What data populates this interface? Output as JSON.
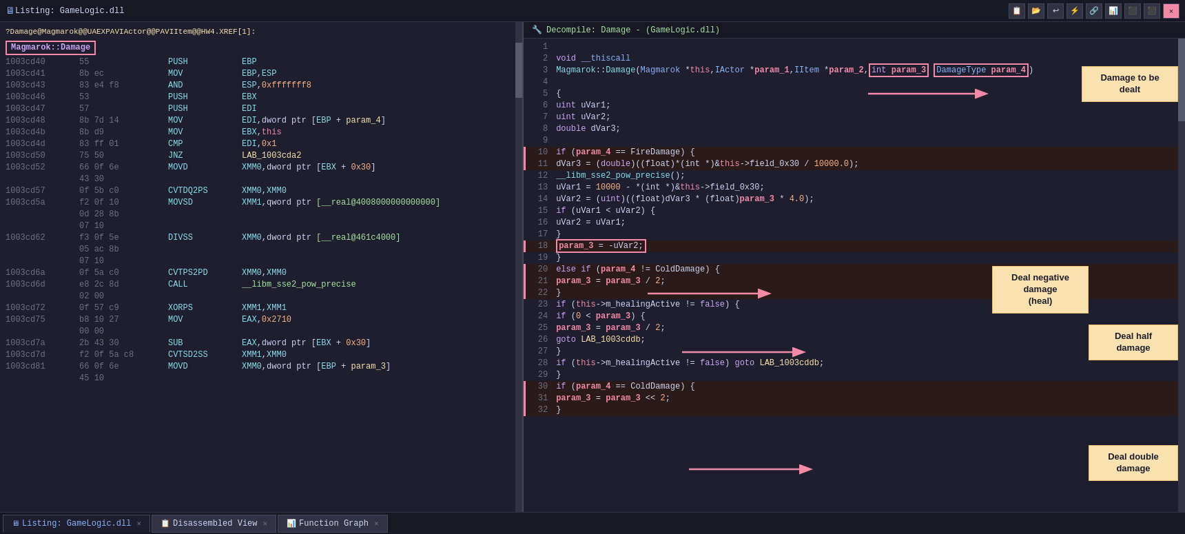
{
  "toolbar": {
    "title": "Listing:  GameLogic.dll",
    "close_label": "×",
    "icons": [
      "📋",
      "📂",
      "↩",
      "⚡",
      "🔗",
      "📊",
      "⬛"
    ]
  },
  "decompile_header": {
    "title": "Decompile: Damage -  (GameLogic.dll)"
  },
  "listing": {
    "xref_line": "?Damage@Magmarok@@UAEXPAVIActor@@PAVIItem@@HW4.XREF[1]:",
    "damage_label": "Magmarok::Damage",
    "rows": [
      {
        "addr": "1003cd40",
        "bytes": "55",
        "mnem": "PUSH",
        "op": "EBP"
      },
      {
        "addr": "1003cd41",
        "bytes": "8b ec",
        "mnem": "MOV",
        "op": "EBP,ESP"
      },
      {
        "addr": "1003cd43",
        "bytes": "83 e4 f8",
        "mnem": "AND",
        "op": "ESP,0xfffffff8"
      },
      {
        "addr": "1003cd46",
        "bytes": "53",
        "mnem": "PUSH",
        "op": "EBX"
      },
      {
        "addr": "1003cd47",
        "bytes": "57",
        "mnem": "PUSH",
        "op": "EDI"
      },
      {
        "addr": "1003cd48",
        "bytes": "8b 7d 14",
        "mnem": "MOV",
        "op": "EDI,dword ptr [EBP + param_4]"
      },
      {
        "addr": "1003cd4b",
        "bytes": "8b d9",
        "mnem": "MOV",
        "op": "EBX,this"
      },
      {
        "addr": "1003cd4d",
        "bytes": "83 ff 01",
        "mnem": "CMP",
        "op": "EDI,0x1"
      },
      {
        "addr": "1003cd50",
        "bytes": "75 50",
        "mnem": "JNZ",
        "op": "LAB_1003cda2"
      },
      {
        "addr": "1003cd52",
        "bytes": "66 0f 6e",
        "mnem": "MOVD",
        "op": "XMM0,dword ptr [EBX + 0x30]"
      },
      {
        "addr": "",
        "bytes": "43 30",
        "mnem": "",
        "op": ""
      },
      {
        "addr": "1003cd57",
        "bytes": "0f 5b c0",
        "mnem": "CVTDQ2PS",
        "op": "XMM0,XMM0"
      },
      {
        "addr": "1003cd5a",
        "bytes": "f2 0f 10",
        "mnem": "MOVSD",
        "op": "XMM1,qword ptr [__real@4008000000000000]"
      },
      {
        "addr": "",
        "bytes": "0d 28 8b",
        "mnem": "",
        "op": ""
      },
      {
        "addr": "",
        "bytes": "07 10",
        "mnem": "",
        "op": ""
      },
      {
        "addr": "1003cd62",
        "bytes": "f3 0f 5e",
        "mnem": "DIVSS",
        "op": "XMM0,dword ptr [__real@461c4000]"
      },
      {
        "addr": "",
        "bytes": "05 ac 8b",
        "mnem": "",
        "op": ""
      },
      {
        "addr": "",
        "bytes": "07 10",
        "mnem": "",
        "op": ""
      },
      {
        "addr": "1003cd6a",
        "bytes": "0f 5a c0",
        "mnem": "CVTPS2PD",
        "op": "XMM0,XMM0"
      },
      {
        "addr": "1003cd6d",
        "bytes": "e8 2c 8d",
        "mnem": "CALL",
        "op": "__libm_sse2_pow_precise"
      },
      {
        "addr": "",
        "bytes": "02 00",
        "mnem": "",
        "op": ""
      },
      {
        "addr": "1003cd72",
        "bytes": "0f 57 c9",
        "mnem": "XORPS",
        "op": "XMM1,XMM1"
      },
      {
        "addr": "1003cd75",
        "bytes": "b8 10 27",
        "mnem": "MOV",
        "op": "EAX,0x2710"
      },
      {
        "addr": "",
        "bytes": "00 00",
        "mnem": "",
        "op": ""
      },
      {
        "addr": "1003cd7a",
        "bytes": "2b 43 30",
        "mnem": "SUB",
        "op": "EAX,dword ptr [EBX + 0x30]"
      },
      {
        "addr": "1003cd7d",
        "bytes": "f2 0f 5a c8",
        "mnem": "CVTSD2SS",
        "op": "XMM1,XMM0"
      },
      {
        "addr": "1003cd81",
        "bytes": "66 0f 6e",
        "mnem": "MOVD",
        "op": "XMM0,dword ptr [EBP + param_3]"
      },
      {
        "addr": "",
        "bytes": "45 10",
        "mnem": "",
        "op": ""
      }
    ]
  },
  "decompile": {
    "lines": [
      {
        "num": "1",
        "code": ""
      },
      {
        "num": "2",
        "code": "void __thiscall"
      },
      {
        "num": "3",
        "code": "Magmarok::Damage(Magmarok *this,IActor *param_1,IItem *param_2,int param_3, DamageType param_4)"
      },
      {
        "num": "4",
        "code": ""
      },
      {
        "num": "5",
        "code": "{"
      },
      {
        "num": "6",
        "code": "  uint uVar1;"
      },
      {
        "num": "7",
        "code": "  uint uVar2;"
      },
      {
        "num": "8",
        "code": "  double dVar3;"
      },
      {
        "num": "9",
        "code": ""
      },
      {
        "num": "10",
        "code": "  if (param_4 == FireDamage) {"
      },
      {
        "num": "11",
        "code": "    dVar3 = (double)((float)*(int *)&this->field_0x30 / 10000.0);"
      },
      {
        "num": "12",
        "code": "    __libm_sse2_pow_precise();"
      },
      {
        "num": "13",
        "code": "    uVar1 = 10000 - *(int *)&this->field_0x30;"
      },
      {
        "num": "14",
        "code": "    uVar2 = (uint)((float)dVar3 * (float)param_3 * 4.0);"
      },
      {
        "num": "15",
        "code": "    if (uVar1 < uVar2) {"
      },
      {
        "num": "16",
        "code": "      uVar2 = uVar1;"
      },
      {
        "num": "17",
        "code": "    }"
      },
      {
        "num": "18",
        "code": "    param_3 = -uVar2;"
      },
      {
        "num": "19",
        "code": "  }"
      },
      {
        "num": "20",
        "code": "  else if (param_4 != ColdDamage) {"
      },
      {
        "num": "21",
        "code": "    param_3 = param_3 / 2;"
      },
      {
        "num": "22",
        "code": "  }"
      },
      {
        "num": "23",
        "code": "  if (this->m_healingActive != false) {"
      },
      {
        "num": "24",
        "code": "    if (0 < param_3) {"
      },
      {
        "num": "25",
        "code": "      param_3 = param_3 / 2;"
      },
      {
        "num": "26",
        "code": "      goto LAB_1003cddb;"
      },
      {
        "num": "27",
        "code": "    }"
      },
      {
        "num": "28",
        "code": "    if (this->m_healingActive != false) goto LAB_1003cddb;"
      },
      {
        "num": "29",
        "code": "  }"
      },
      {
        "num": "30",
        "code": "  if (param_4 == ColdDamage) {"
      },
      {
        "num": "31",
        "code": "    param_3 = param_3 << 2;"
      },
      {
        "num": "32",
        "code": "  }"
      }
    ]
  },
  "annotations": {
    "damage_to_be_dealt": "Damage to be dealt",
    "deal_negative": "Deal negative\ndamage\n(heal)",
    "deal_half": "Deal half\ndamage",
    "deal_double": "Deal double\ndamage"
  },
  "tabs": {
    "left_tabs": [
      {
        "label": "Listing: GameLogic.dll",
        "active": true
      },
      {
        "label": "Disassembled View",
        "active": false
      },
      {
        "label": "Function Graph",
        "active": false
      }
    ]
  },
  "colors": {
    "accent_red": "#f38ba8",
    "accent_yellow": "#f9e2af",
    "accent_green": "#a6e3a1",
    "accent_blue": "#89b4fa",
    "accent_purple": "#cba6f7",
    "bg_dark": "#1e1e2e",
    "bg_darker": "#181825"
  }
}
